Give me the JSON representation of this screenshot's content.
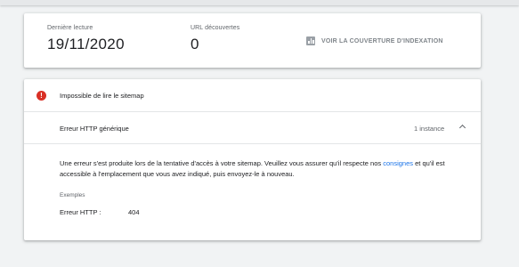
{
  "stats": {
    "last_read_label": "Dernière lecture",
    "last_read_value": "19/11/2020",
    "urls_label": "URL découvertes",
    "urls_value": "0",
    "coverage_link": "VOIR LA COUVERTURE D'INDEXATION",
    "coverage_icon": "bar-chart-icon"
  },
  "error": {
    "icon": "error-icon",
    "color": "#d93025",
    "title": "Impossible de lire le sitemap",
    "detail_title": "Erreur HTTP générique",
    "instance_count": "1 instance",
    "description_before": "Une erreur s'est produite lors de la tentative d'accès à votre sitemap. Veuillez vous assurer qu'il respecte nos ",
    "description_link": "consignes",
    "description_after": " et qu'il est accessible à l'emplacement que vous avez indiqué, puis envoyez-le à nouveau.",
    "examples_label": "Exemples",
    "example_key": "Erreur HTTP :",
    "example_value": "404"
  },
  "colors": {
    "link": "#1a73e8",
    "background": "#f1f3f4"
  }
}
